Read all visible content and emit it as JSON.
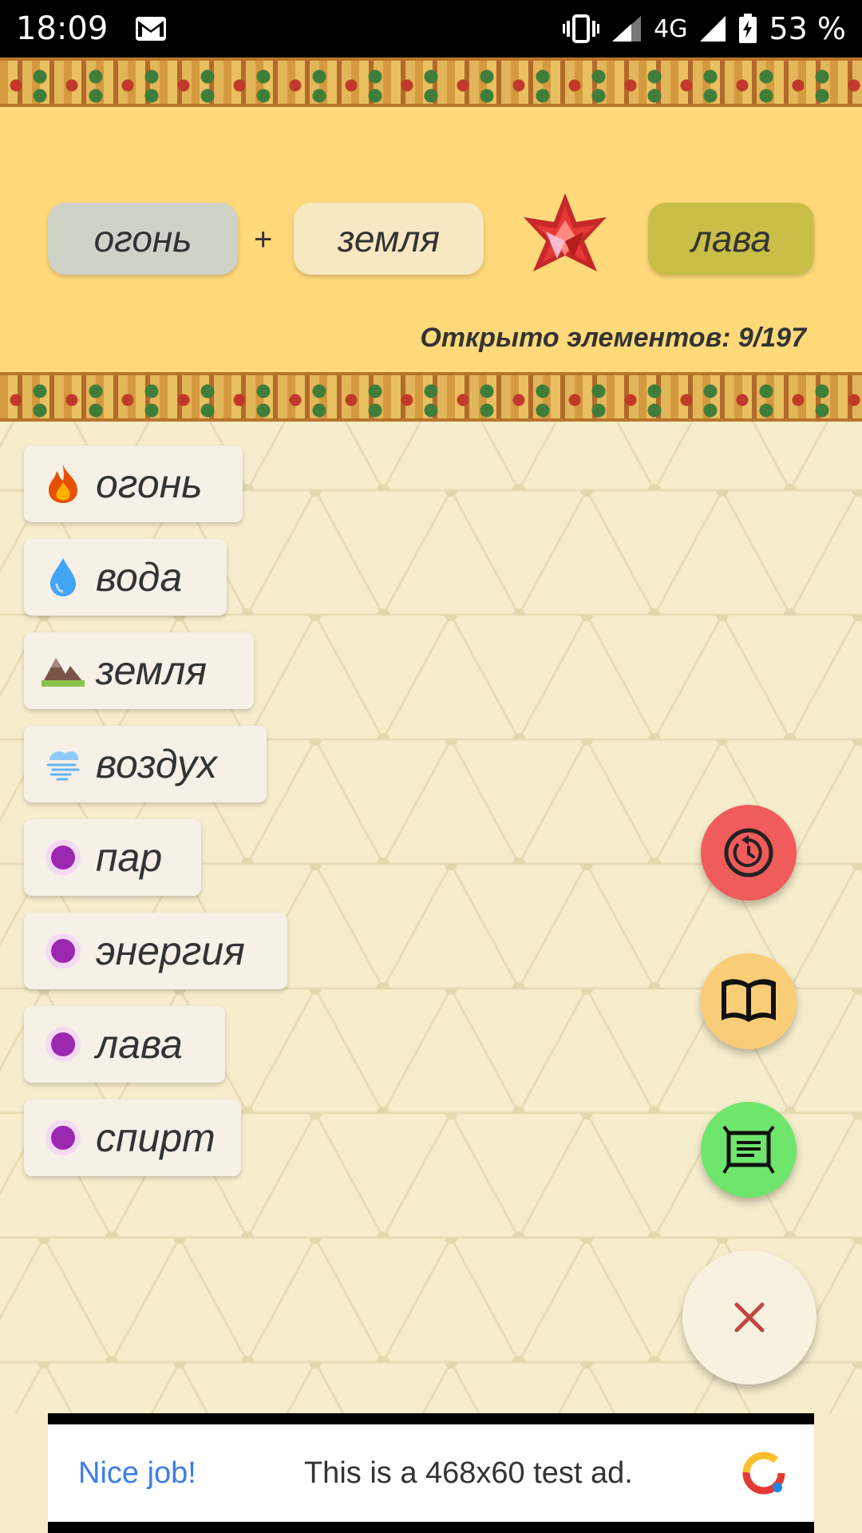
{
  "status_bar": {
    "time": "18:09",
    "network": "4G",
    "battery": "53 %",
    "icons": [
      "mail-icon",
      "vibrate-icon",
      "signal-icon",
      "battery-icon"
    ]
  },
  "combination": {
    "ingredient_a": "огонь",
    "plus": "+",
    "ingredient_b": "земля",
    "result": "лава",
    "colors": {
      "ingredient_a": "#cfd2c7",
      "ingredient_b": "#f7e8c2",
      "result": "#c9be47"
    }
  },
  "counter": {
    "text": "Открыто элементов: 9/197"
  },
  "elements": [
    {
      "label": "огонь",
      "icon": "fire-icon"
    },
    {
      "label": "вода",
      "icon": "water-drop-icon"
    },
    {
      "label": "земля",
      "icon": "mountain-icon"
    },
    {
      "label": "воздух",
      "icon": "wind-icon"
    },
    {
      "label": "пар",
      "icon": "purple-dot-icon"
    },
    {
      "label": "энергия",
      "icon": "purple-dot-icon"
    },
    {
      "label": "лава",
      "icon": "purple-dot-icon"
    },
    {
      "label": "спирт",
      "icon": "purple-dot-icon"
    }
  ],
  "fabs": {
    "reset": {
      "icon": "reset-timer-icon",
      "color": "#f05b5b"
    },
    "book": {
      "icon": "book-icon",
      "color": "#f9cc76"
    },
    "list": {
      "icon": "list-board-icon",
      "color": "#6ee66c"
    },
    "close": {
      "icon": "close-icon",
      "color": "#f9f1e0"
    }
  },
  "ad": {
    "title": "Nice job!",
    "text": "This is a 468x60 test ad."
  }
}
